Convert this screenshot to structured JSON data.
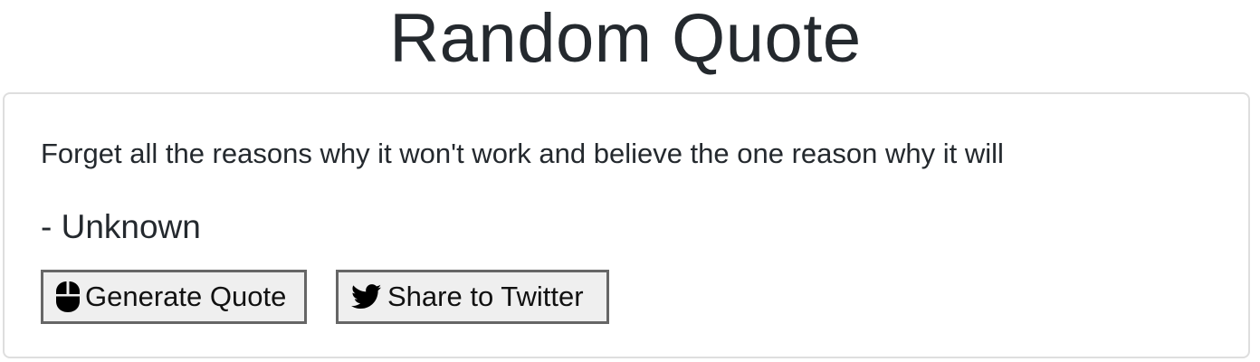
{
  "page": {
    "title": "Random Quote"
  },
  "quote": {
    "text": "Forget all the reasons why it won't work and believe the one reason why it will",
    "author": "- Unknown"
  },
  "buttons": {
    "generate": {
      "label": "Generate Quote",
      "icon": "mouse-icon"
    },
    "share": {
      "label": "Share to Twitter",
      "icon": "twitter-icon"
    }
  },
  "colors": {
    "text": "#24292e",
    "card_border": "#dedede",
    "button_bg": "#efefef",
    "button_border": "#666666"
  }
}
